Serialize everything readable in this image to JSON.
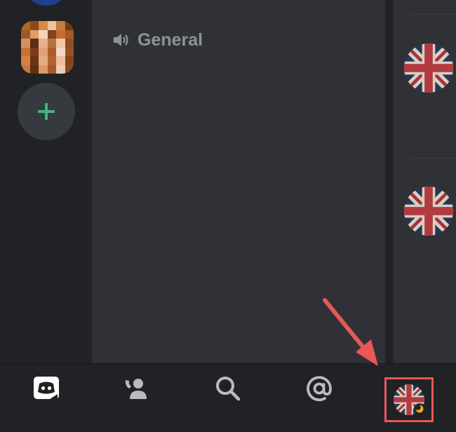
{
  "channel": {
    "name": "General",
    "icon": "speaker-icon"
  },
  "server_rail": {
    "add_button_icon": "plus-icon"
  },
  "members": {
    "avatar_icon": "union-jack-avatar"
  },
  "bottom_nav": {
    "items": [
      {
        "name": "home",
        "icon": "discord-logo-icon"
      },
      {
        "name": "friends",
        "icon": "friends-icon"
      },
      {
        "name": "search",
        "icon": "search-icon"
      },
      {
        "name": "mentions",
        "icon": "at-sign-icon"
      },
      {
        "name": "profile",
        "icon": "union-jack-avatar",
        "status": "idle"
      }
    ]
  },
  "colors": {
    "background": "#202225",
    "panel": "#2f3136",
    "accent_green": "#43b581",
    "highlight_red": "#e95757",
    "idle_yellow": "#faa61a",
    "muted_text": "#8e9297"
  }
}
